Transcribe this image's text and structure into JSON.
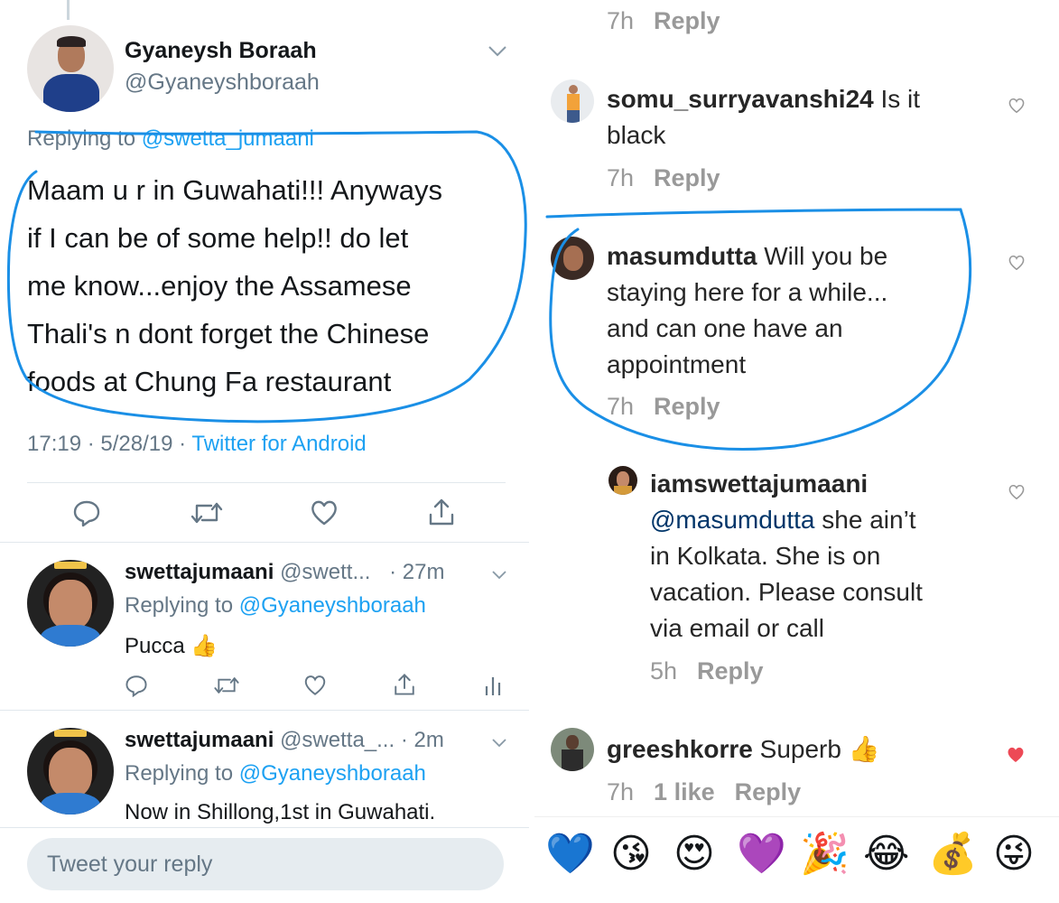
{
  "tweet": {
    "author_name": "Gyaneysh Boraah",
    "author_handle": "@Gyaneyshboraah",
    "replying_prefix": "Replying to",
    "replying_to": "@swetta_jumaani",
    "text_lines": [
      "Maam u r in Guwahati!!! Anyways",
      "if I can be of some help!! do let",
      "me know...enjoy the Assamese",
      "Thali's n dont forget the Chinese",
      "foods at Chung Fa restaurant"
    ],
    "timestamp": "17:19 · 5/28/19 ·",
    "source": "Twitter for Android"
  },
  "replies": [
    {
      "name": "swettajumaani",
      "handle": "@swett...",
      "age": "· 27m",
      "replying_prefix": "Replying to",
      "replying_to": "@Gyaneyshboraah",
      "text": "Pucca 👍"
    },
    {
      "name": "swettajumaani",
      "handle": "@swetta_...",
      "age": "· 2m",
      "replying_prefix": "Replying to",
      "replying_to": "@Gyaneyshboraah",
      "text": "Now in Shillong,1st in Guwahati."
    }
  ],
  "composer": {
    "placeholder": "Tweet your reply"
  },
  "instagram": {
    "top_time": "7h",
    "reply_label": "Reply",
    "comments": [
      {
        "user": "somu_surryavanshi24",
        "lines": [
          "Is it",
          "black"
        ],
        "time": "7h"
      },
      {
        "user": "masumdutta",
        "lines": [
          "Will you be",
          "staying here for a while...",
          "and can one have an",
          "appointment"
        ],
        "time": "7h"
      },
      {
        "user": "iamswettajumaani",
        "mention": "@masumdutta",
        "lines": [
          "she ain’t",
          "in Kolkata. She is on",
          "vacation. Please consult",
          "via email or call"
        ],
        "time": "5h"
      },
      {
        "user": "greeshkorre",
        "lines": [
          "Superb 👍"
        ],
        "time": "7h",
        "likes": "1 like",
        "liked": true
      }
    ],
    "emoji_bar": [
      "💙",
      "😘",
      "😍",
      "💜",
      "🎉",
      "😂",
      "💰",
      "😜"
    ],
    "colors": {
      "heart_liked": "#ed4956",
      "scribble": "#1a8fe6"
    }
  }
}
